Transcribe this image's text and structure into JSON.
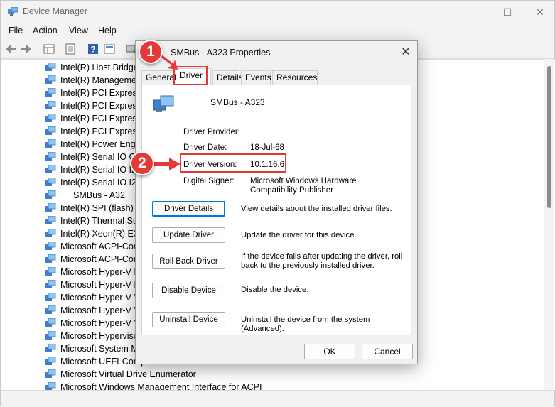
{
  "main_window": {
    "title": "Device Manager",
    "menu": [
      "File",
      "Action",
      "View",
      "Help"
    ],
    "window_controls": {
      "minimize": "—",
      "maximize": "☐",
      "close": "✕"
    },
    "tree_items": [
      "Intel(R) Host Bridge/",
      "Intel(R) Management",
      "Intel(R) PCI Express R",
      "Intel(R) PCI Express R",
      "Intel(R) PCI Express R",
      "Intel(R) PCI Express R",
      "Intel(R) Power Engin",
      "Intel(R) Serial IO GP",
      "Intel(R) Serial IO I2",
      "Intel(R) Serial IO I2C",
      "SMBus - A32",
      "Intel(R) SPI (flash) Co",
      "Intel(R) Thermal Sub",
      "Intel(R) Xeon(R) E3 -",
      "Microsoft ACPI-Com",
      "Microsoft ACPI-Com",
      "Microsoft Hyper-V N",
      "Microsoft Hyper-V P",
      "Microsoft Hyper-V V",
      "Microsoft Hyper-V V",
      "Microsoft Hyper-V V",
      "Microsoft Hyperviso",
      "Microsoft System M",
      "Microsoft UEFI-Comp",
      "Microsoft Virtual Drive Enumerator",
      "Microsoft Windows Management Interface for ACPI"
    ]
  },
  "dialog": {
    "title": "SMBus - A323 Properties",
    "close_glyph": "✕",
    "tabs": {
      "general": "General",
      "driver": "Driver",
      "details": "Details",
      "events": "Events",
      "resources": "Resources"
    },
    "device_name": "SMBus - A323",
    "info": {
      "provider_label": "Driver Provider:",
      "provider_value": "",
      "date_label": "Driver Date:",
      "date_value": "18-Jul-68",
      "version_label": "Driver Version:",
      "version_value": "10.1.16.6",
      "signer_label": "Digital Signer:",
      "signer_value": "Microsoft Windows Hardware Compatibility Publisher"
    },
    "actions": {
      "driver_details": {
        "label": "Driver Details",
        "desc": "View details about the installed driver files."
      },
      "update_driver": {
        "label": "Update Driver",
        "desc": "Update the driver for this device."
      },
      "roll_back": {
        "label": "Roll Back Driver",
        "desc": "If the device fails after updating the driver, roll back to the previously installed driver."
      },
      "disable": {
        "label": "Disable Device",
        "desc": "Disable the device."
      },
      "uninstall": {
        "label": "Uninstall Device",
        "desc": "Uninstall the device from the system (Advanced)."
      }
    },
    "ok_label": "OK",
    "cancel_label": "Cancel"
  },
  "annotations": {
    "step1": "1",
    "step2": "2",
    "color": "#e53935"
  }
}
